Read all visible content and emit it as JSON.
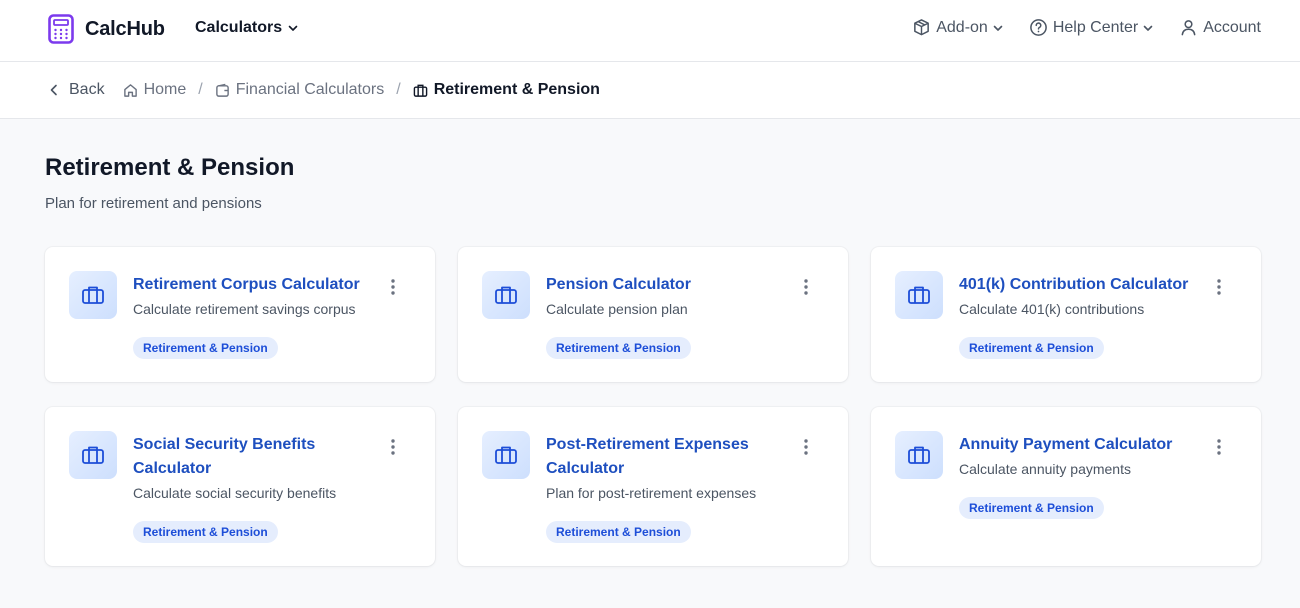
{
  "brand": {
    "name": "CalcHub",
    "icon": "calculator-icon",
    "accent": "#7c3aed"
  },
  "nav": {
    "calculators_label": "Calculators"
  },
  "topright": {
    "addon_label": "Add-on",
    "help_label": "Help Center",
    "account_label": "Account"
  },
  "breadcrumb": {
    "back_label": "Back",
    "home_label": "Home",
    "financial_label": "Financial Calculators",
    "current_label": "Retirement & Pension"
  },
  "page": {
    "title": "Retirement & Pension",
    "subtitle": "Plan for retirement and pensions"
  },
  "cards": [
    {
      "title": "Retirement Corpus Calculator",
      "description": "Calculate retirement savings corpus",
      "tag": "Retirement & Pension",
      "icon": "briefcase-icon"
    },
    {
      "title": "Pension Calculator",
      "description": "Calculate pension plan",
      "tag": "Retirement & Pension",
      "icon": "briefcase-icon"
    },
    {
      "title": "401(k) Contribution Calculator",
      "description": "Calculate 401(k) contributions",
      "tag": "Retirement & Pension",
      "icon": "briefcase-icon"
    },
    {
      "title": "Social Security Benefits Calculator",
      "description": "Calculate social security benefits",
      "tag": "Retirement & Pension",
      "icon": "briefcase-icon"
    },
    {
      "title": "Post-Retirement Expenses Calculator",
      "description": "Plan for post-retirement expenses",
      "tag": "Retirement & Pension",
      "icon": "briefcase-icon"
    },
    {
      "title": "Annuity Payment Calculator",
      "description": "Calculate annuity payments",
      "tag": "Retirement & Pension",
      "icon": "briefcase-icon"
    }
  ],
  "colors": {
    "link": "#1e4fbf",
    "tag_bg": "#e5edfd",
    "tag_text": "#1d4ed8",
    "page_bg": "#f8f9fb"
  }
}
